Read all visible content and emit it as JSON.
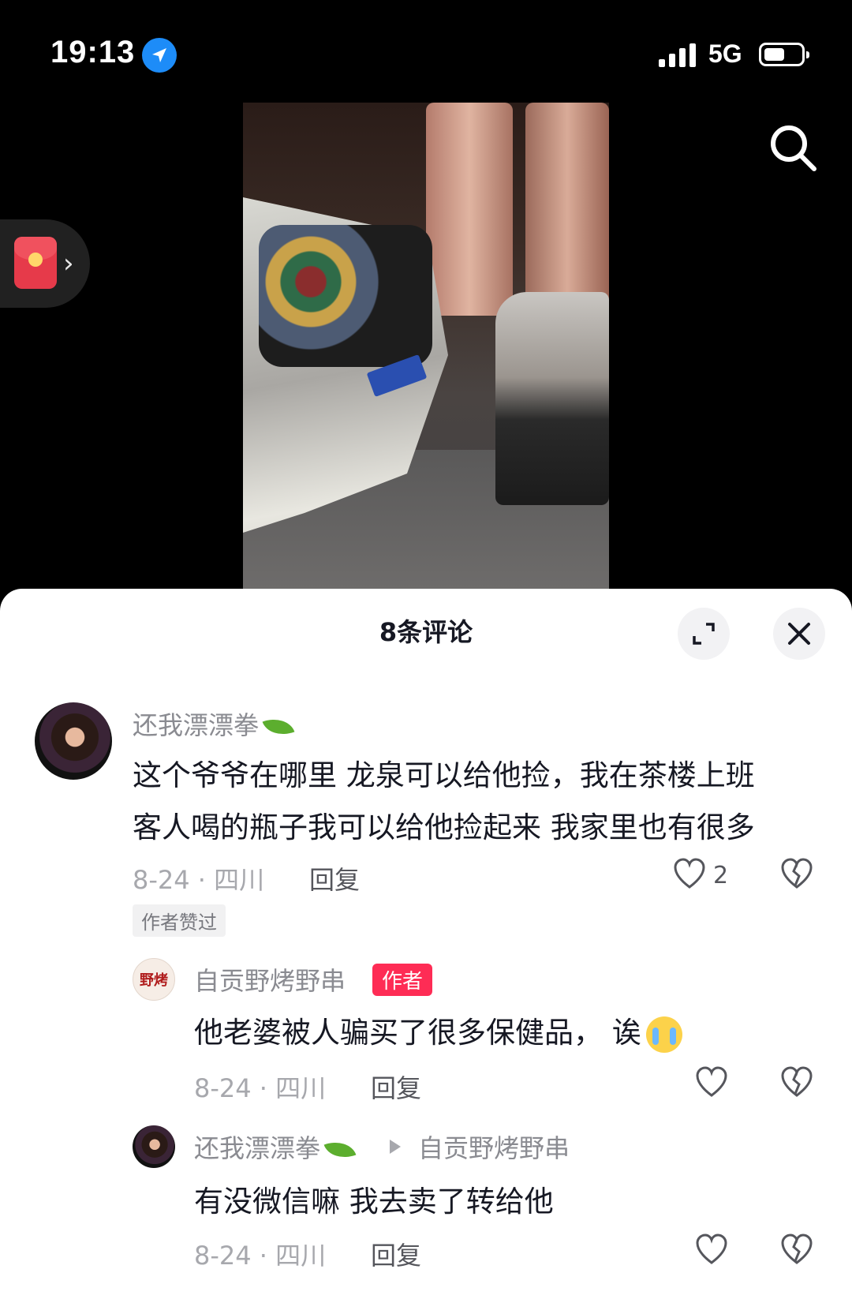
{
  "status_bar": {
    "time": "19:13",
    "network": "5G",
    "battery_level": 0.55
  },
  "sheet": {
    "title": "8条评论"
  },
  "comments": [
    {
      "username": "还我漂漂拳",
      "text_line1": "这个爷爷在哪里 龙泉可以给他捡，我在茶楼上班",
      "text_line2": "客人喝的瓶子我可以给他捡起来 我家里也有很多",
      "meta": "8-24 · 四川",
      "reply_label": "回复",
      "likes": "2",
      "author_liked": "作者赞过"
    },
    {
      "username": "自贡野烤野串",
      "author_tag": "作者",
      "avatar_text": "野烤",
      "text": "他老婆被人骗买了很多保健品，  诶",
      "meta": "8-24 · 四川",
      "reply_label": "回复"
    },
    {
      "username": "还我漂漂拳",
      "reply_to": "自贡野烤野串",
      "text": "有没微信嘛 我去卖了转给他",
      "meta": "8-24 · 四川",
      "reply_label": "回复"
    }
  ]
}
